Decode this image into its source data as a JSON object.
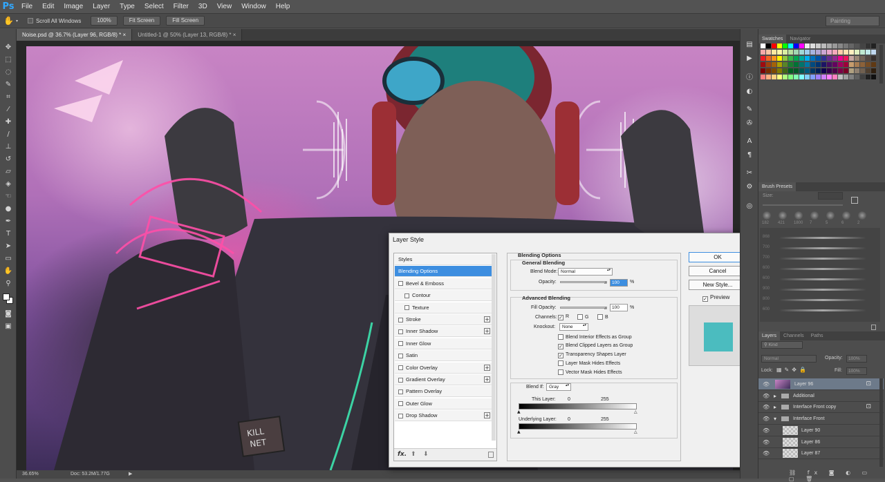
{
  "app": {
    "logo": "Ps"
  },
  "menu": [
    "File",
    "Edit",
    "Image",
    "Layer",
    "Type",
    "Select",
    "Filter",
    "3D",
    "View",
    "Window",
    "Help"
  ],
  "options": {
    "scroll_all": "Scroll All Windows",
    "zoom100": "100%",
    "fit_screen": "Fit Screen",
    "fill_screen": "Fill Screen",
    "workspace": "Painting"
  },
  "tabs": [
    {
      "label": "Noise.psd @ 36.7% (Layer 96, RGB/8) *",
      "close": "×"
    },
    {
      "label": "Untitled-1 @ 50% (Layer 13, RGB/8) *",
      "close": "×"
    }
  ],
  "status": {
    "zoom": "36.65%",
    "doc": "Doc: 53.2M/1.77G"
  },
  "dialog": {
    "title": "Layer Style",
    "close": "✕",
    "styles": [
      {
        "label": "Styles",
        "checkbox": false,
        "plus": false,
        "selected": false
      },
      {
        "label": "Blending Options",
        "checkbox": false,
        "plus": false,
        "selected": true
      },
      {
        "label": "Bevel & Emboss",
        "checkbox": true,
        "plus": false,
        "selected": false
      },
      {
        "label": "Contour",
        "checkbox": true,
        "plus": false,
        "selected": false,
        "indent": true
      },
      {
        "label": "Texture",
        "checkbox": true,
        "plus": false,
        "selected": false,
        "indent": true
      },
      {
        "label": "Stroke",
        "checkbox": true,
        "plus": true,
        "selected": false
      },
      {
        "label": "Inner Shadow",
        "checkbox": true,
        "plus": true,
        "selected": false
      },
      {
        "label": "Inner Glow",
        "checkbox": true,
        "plus": false,
        "selected": false
      },
      {
        "label": "Satin",
        "checkbox": true,
        "plus": false,
        "selected": false
      },
      {
        "label": "Color Overlay",
        "checkbox": true,
        "plus": true,
        "selected": false
      },
      {
        "label": "Gradient Overlay",
        "checkbox": true,
        "plus": true,
        "selected": false
      },
      {
        "label": "Pattern Overlay",
        "checkbox": true,
        "plus": false,
        "selected": false
      },
      {
        "label": "Outer Glow",
        "checkbox": true,
        "plus": false,
        "selected": false
      },
      {
        "label": "Drop Shadow",
        "checkbox": true,
        "plus": true,
        "selected": false
      }
    ],
    "footer": {
      "fx": "fx.",
      "up": "⬆",
      "down": "⬇",
      "trash": "🗑"
    },
    "blending": {
      "title": "Blending Options",
      "general": "General Blending",
      "blend_mode_label": "Blend Mode:",
      "blend_mode": "Normal",
      "opacity_label": "Opacity:",
      "opacity": "100",
      "pct": "%",
      "advanced": "Advanced Blending",
      "fill_label": "Fill Opacity:",
      "fill": "100",
      "channels_label": "Channels:",
      "ch_r": "R",
      "ch_g": "G",
      "ch_b": "B",
      "knockout_label": "Knockout:",
      "knockout": "None",
      "options": [
        {
          "label": "Blend Interior Effects as Group",
          "checked": false
        },
        {
          "label": "Blend Clipped Layers as Group",
          "checked": true
        },
        {
          "label": "Transparency Shapes Layer",
          "checked": true
        },
        {
          "label": "Layer Mask Hides Effects",
          "checked": false
        },
        {
          "label": "Vector Mask Hides Effects",
          "checked": false
        }
      ],
      "blendif_label": "Blend If:",
      "blendif": "Gray",
      "this_layer": "This Layer:",
      "underlying": "Underlying Layer:",
      "min": "0",
      "max": "255"
    },
    "buttons": {
      "ok": "OK",
      "cancel": "Cancel",
      "new_style": "New Style...",
      "preview": "Preview"
    },
    "preview_color": "#4bbcbf"
  },
  "panels": {
    "swatches_tabs": [
      "Swatches",
      "Navigator"
    ],
    "brush_tab": "Brush Presets",
    "size_label": "Size:",
    "brush_sizes": [
      "182",
      "421",
      "1800",
      "7",
      "5",
      "6",
      "2"
    ],
    "brush_side": [
      "868",
      "700",
      "700",
      "600",
      "600",
      "900",
      "800",
      "600"
    ],
    "layers_tabs": [
      "Layers",
      "Channels",
      "Paths"
    ],
    "kind": "Kind",
    "blend": "Normal",
    "opacity_label": "Opacity:",
    "opacity": "100%",
    "lock_label": "Lock:",
    "fill_label": "Fill:",
    "fill": "100%",
    "layers": [
      {
        "name": "Layer 96",
        "type": "art",
        "selected": true
      },
      {
        "name": "Additional",
        "type": "folder"
      },
      {
        "name": "Interface Front copy",
        "type": "folder"
      },
      {
        "name": "Interface Front",
        "type": "folder-open"
      },
      {
        "name": "Layer 90",
        "type": "layer"
      },
      {
        "name": "Layer 86",
        "type": "layer"
      },
      {
        "name": "Layer 87",
        "type": "layer"
      }
    ]
  }
}
